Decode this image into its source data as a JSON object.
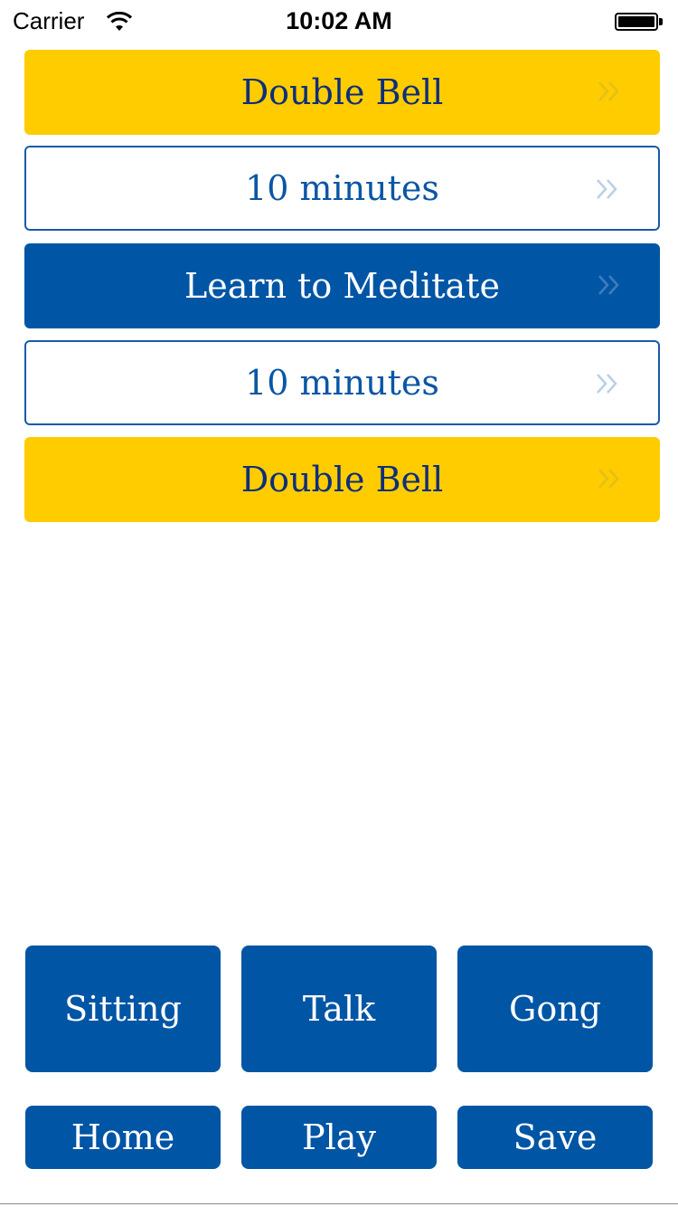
{
  "status_bar": {
    "carrier": "Carrier",
    "time": "10:02 AM",
    "wifi_icon": "wifi-icon",
    "battery_icon": "battery-icon"
  },
  "sequence": [
    {
      "label": "Double Bell",
      "style": "yellow",
      "icon": "double-chevron-right-icon"
    },
    {
      "label": "10 minutes",
      "style": "white",
      "icon": "double-chevron-right-icon"
    },
    {
      "label": "Learn to Meditate",
      "style": "blue",
      "icon": "double-chevron-right-icon"
    },
    {
      "label": "10 minutes",
      "style": "white",
      "icon": "double-chevron-right-icon"
    },
    {
      "label": "Double Bell",
      "style": "yellow",
      "icon": "double-chevron-right-icon"
    }
  ],
  "add_buttons": {
    "sitting": "Sitting",
    "talk": "Talk",
    "gong": "Gong"
  },
  "actions": {
    "home": "Home",
    "play": "Play",
    "save": "Save"
  },
  "colors": {
    "accent_blue": "#0055a5",
    "accent_yellow": "#ffcc00",
    "text_navy": "#0d2e7a",
    "background": "#ffffff"
  }
}
